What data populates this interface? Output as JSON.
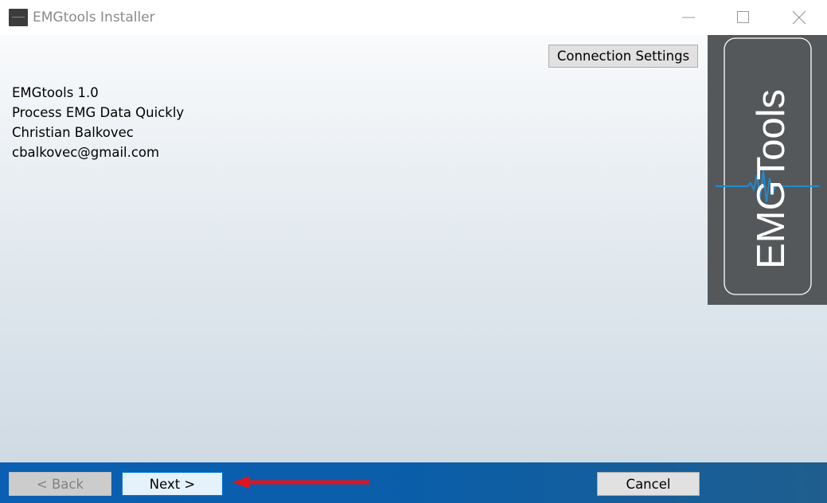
{
  "window": {
    "title": "EMGtools Installer"
  },
  "toolbar": {
    "connection_settings_label": "Connection Settings"
  },
  "info": {
    "product": "EMGtools 1.0",
    "tagline": "Process EMG Data Quickly",
    "author": "Christian Balkovec",
    "email": "cbalkovec@gmail.com"
  },
  "logo": {
    "text": "EMGTools",
    "panel_color": "#55585a",
    "accent_color": "#1f8bd1"
  },
  "footer": {
    "back_label": "< Back",
    "next_label": "Next >",
    "cancel_label": "Cancel",
    "bar_color": "#0b5fb3",
    "annotation_arrow_color": "#e0141e"
  },
  "icons": [
    "app-icon",
    "minimize-icon",
    "maximize-icon",
    "close-icon",
    "red-arrow-icon"
  ]
}
